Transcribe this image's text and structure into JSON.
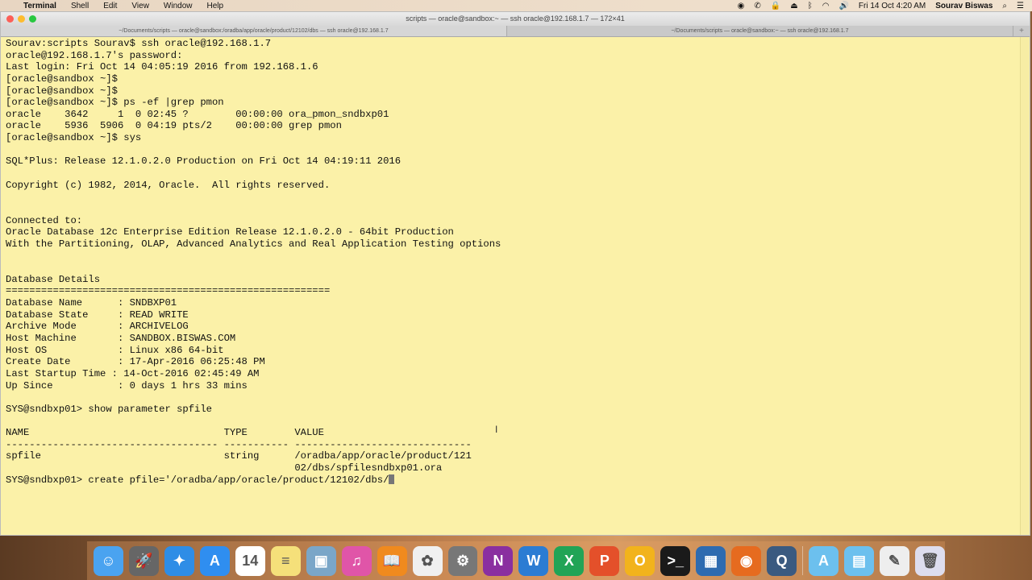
{
  "menubar": {
    "app": "Terminal",
    "items": [
      "Shell",
      "Edit",
      "View",
      "Window",
      "Help"
    ],
    "clock": "Fri 14 Oct  4:20 AM",
    "user": "Sourav Biswas"
  },
  "window": {
    "title": "scripts — oracle@sandbox:~ — ssh oracle@192.168.1.7 — 172×41",
    "tabs": [
      "~/Documents/scripts — oracle@sandbox:/oradba/app/oracle/product/12102/dbs — ssh oracle@192.168.1.7",
      "~/Documents/scripts — oracle@sandbox:~ — ssh oracle@192.168.1.7"
    ],
    "new_tab": "+"
  },
  "terminal": {
    "lines": [
      "Sourav:scripts Sourav$ ssh oracle@192.168.1.7",
      "oracle@192.168.1.7's password:",
      "Last login: Fri Oct 14 04:05:19 2016 from 192.168.1.6",
      "[oracle@sandbox ~]$",
      "[oracle@sandbox ~]$",
      "[oracle@sandbox ~]$ ps -ef |grep pmon",
      "oracle    3642     1  0 02:45 ?        00:00:00 ora_pmon_sndbxp01",
      "oracle    5936  5906  0 04:19 pts/2    00:00:00 grep pmon",
      "[oracle@sandbox ~]$ sys",
      "",
      "SQL*Plus: Release 12.1.0.2.0 Production on Fri Oct 14 04:19:11 2016",
      "",
      "Copyright (c) 1982, 2014, Oracle.  All rights reserved.",
      "",
      "",
      "Connected to:",
      "Oracle Database 12c Enterprise Edition Release 12.1.0.2.0 - 64bit Production",
      "With the Partitioning, OLAP, Advanced Analytics and Real Application Testing options",
      "",
      "",
      "Database Details",
      "=======================================================",
      "Database Name      : SNDBXP01",
      "Database State     : READ WRITE",
      "Archive Mode       : ARCHIVELOG",
      "Host Machine       : SANDBOX.BISWAS.COM",
      "Host OS            : Linux x86 64-bit",
      "Create Date        : 17-Apr-2016 06:25:48 PM",
      "Last Startup Time : 14-Oct-2016 02:45:49 AM",
      "Up Since           : 0 days 1 hrs 33 mins",
      "",
      "SYS@sndbxp01> show parameter spfile",
      "",
      "NAME                                 TYPE        VALUE",
      "------------------------------------ ----------- ------------------------------",
      "spfile                               string      /oradba/app/oracle/product/121",
      "                                                 02/dbs/spfilesndbxp01.ora"
    ],
    "prompt": "SYS@sndbxp01> create pfile='/oradba/app/oracle/product/12102/dbs/"
  },
  "dock": [
    {
      "name": "finder",
      "color": "#4aa3f0",
      "glyph": "☺"
    },
    {
      "name": "launchpad",
      "color": "#666",
      "glyph": "🚀"
    },
    {
      "name": "safari",
      "color": "#2e8de6",
      "glyph": "✦"
    },
    {
      "name": "app-store",
      "color": "#2f8ef0",
      "glyph": "A"
    },
    {
      "name": "calendar",
      "color": "#fff",
      "glyph": "14"
    },
    {
      "name": "notes",
      "color": "#f5e07a",
      "glyph": "≡"
    },
    {
      "name": "preview",
      "color": "#7aa6c8",
      "glyph": "▣"
    },
    {
      "name": "itunes",
      "color": "#e055a8",
      "glyph": "♫"
    },
    {
      "name": "ibooks",
      "color": "#f08a1e",
      "glyph": "📖"
    },
    {
      "name": "photos",
      "color": "#f0f0f0",
      "glyph": "✿"
    },
    {
      "name": "system-preferences",
      "color": "#777",
      "glyph": "⚙"
    },
    {
      "name": "onenote",
      "color": "#8a2fa0",
      "glyph": "N"
    },
    {
      "name": "word",
      "color": "#2b7cd3",
      "glyph": "W"
    },
    {
      "name": "excel",
      "color": "#21a456",
      "glyph": "X"
    },
    {
      "name": "powerpoint",
      "color": "#e4502a",
      "glyph": "P"
    },
    {
      "name": "outlook",
      "color": "#f2b31c",
      "glyph": "O"
    },
    {
      "name": "terminal",
      "color": "#1a1a1a",
      "glyph": ">_"
    },
    {
      "name": "virtualbox",
      "color": "#2e6bb0",
      "glyph": "▦"
    },
    {
      "name": "firefox",
      "color": "#e66b1f",
      "glyph": "◉"
    },
    {
      "name": "quicktime",
      "color": "#3a5a80",
      "glyph": "Q"
    },
    {
      "name": "applications-folder",
      "color": "#6cc0ee",
      "glyph": "A"
    },
    {
      "name": "documents-folder",
      "color": "#6cc0ee",
      "glyph": "▤"
    },
    {
      "name": "textedit",
      "color": "#eee",
      "glyph": "✎"
    },
    {
      "name": "trash",
      "color": "#dde",
      "glyph": "🗑"
    }
  ]
}
